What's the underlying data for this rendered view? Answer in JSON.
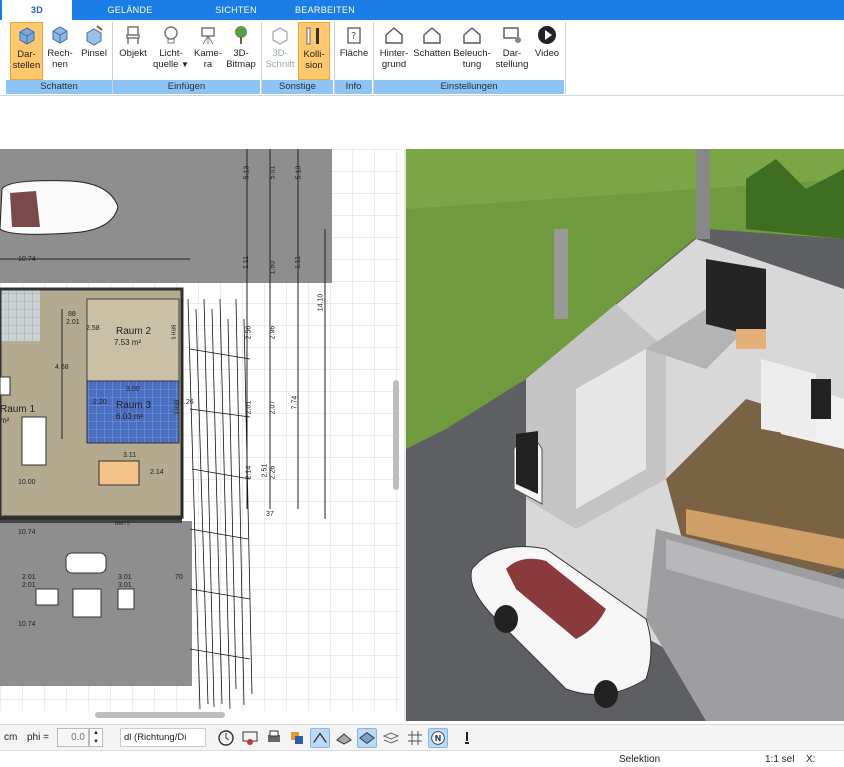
{
  "tabs": [
    "3D",
    "GELÄNDE",
    "SICHTEN",
    "BEARBEITEN"
  ],
  "ribbon": {
    "buttons": [
      {
        "line1": "Dar-",
        "line2": "stellen"
      },
      {
        "line1": "Rech-",
        "line2": "nen"
      },
      {
        "line1": "Pinsel",
        "line2": ""
      },
      {
        "line1": "Objekt",
        "line2": ""
      },
      {
        "line1": "Licht-",
        "line2": "quelle"
      },
      {
        "line1": "Kame-",
        "line2": "ra"
      },
      {
        "line1": "3D-",
        "line2": "Bitmap"
      },
      {
        "line1": "3D-",
        "line2": "Schnitt"
      },
      {
        "line1": "Kolli-",
        "line2": "sion"
      },
      {
        "line1": "Fläche",
        "line2": ""
      },
      {
        "line1": "Hinter-",
        "line2": "grund"
      },
      {
        "line1": "Schatten",
        "line2": ""
      },
      {
        "line1": "Beleuch-",
        "line2": "tung"
      },
      {
        "line1": "Dar-",
        "line2": "stellung"
      },
      {
        "line1": "Video",
        "line2": ""
      }
    ],
    "groups": [
      "Schatten",
      "Einfügen",
      "Sonstige",
      "Info",
      "Einstellungen"
    ]
  },
  "plan": {
    "rooms": [
      {
        "name": "Raum 2",
        "area": "7.53 m²"
      },
      {
        "name": "Raum 3",
        "area": "6.03 m²"
      },
      {
        "name": "Raum 1",
        "area": "m²"
      }
    ],
    "dims": [
      "10.74",
      "10.74",
      "10.00",
      "2.58",
      "2.01",
      "88",
      "4.68",
      "3.00",
      "2.20",
      "2.26",
      "3.11",
      "2.14",
      "2.01",
      "2.01",
      "3.01",
      "3.01",
      "70",
      "10.74",
      "5.13",
      "5.01",
      "5.13",
      "1.11",
      "1.60",
      "1.11",
      "2.56",
      "2.96",
      "2.01",
      "2.07",
      "2.14",
      "2.26",
      "37",
      "2.51",
      "7.74",
      "14.10",
      "BRH 5",
      "BRH 5",
      "BRH 5"
    ]
  },
  "toolbar2": {
    "unit": "cm",
    "phi_label": "phi =",
    "phi_value": "0.0",
    "dropdown": "dl (Richtung/Di"
  },
  "status": {
    "mode": "Selektion",
    "scale": "1:1 sel",
    "coord": "X:"
  }
}
